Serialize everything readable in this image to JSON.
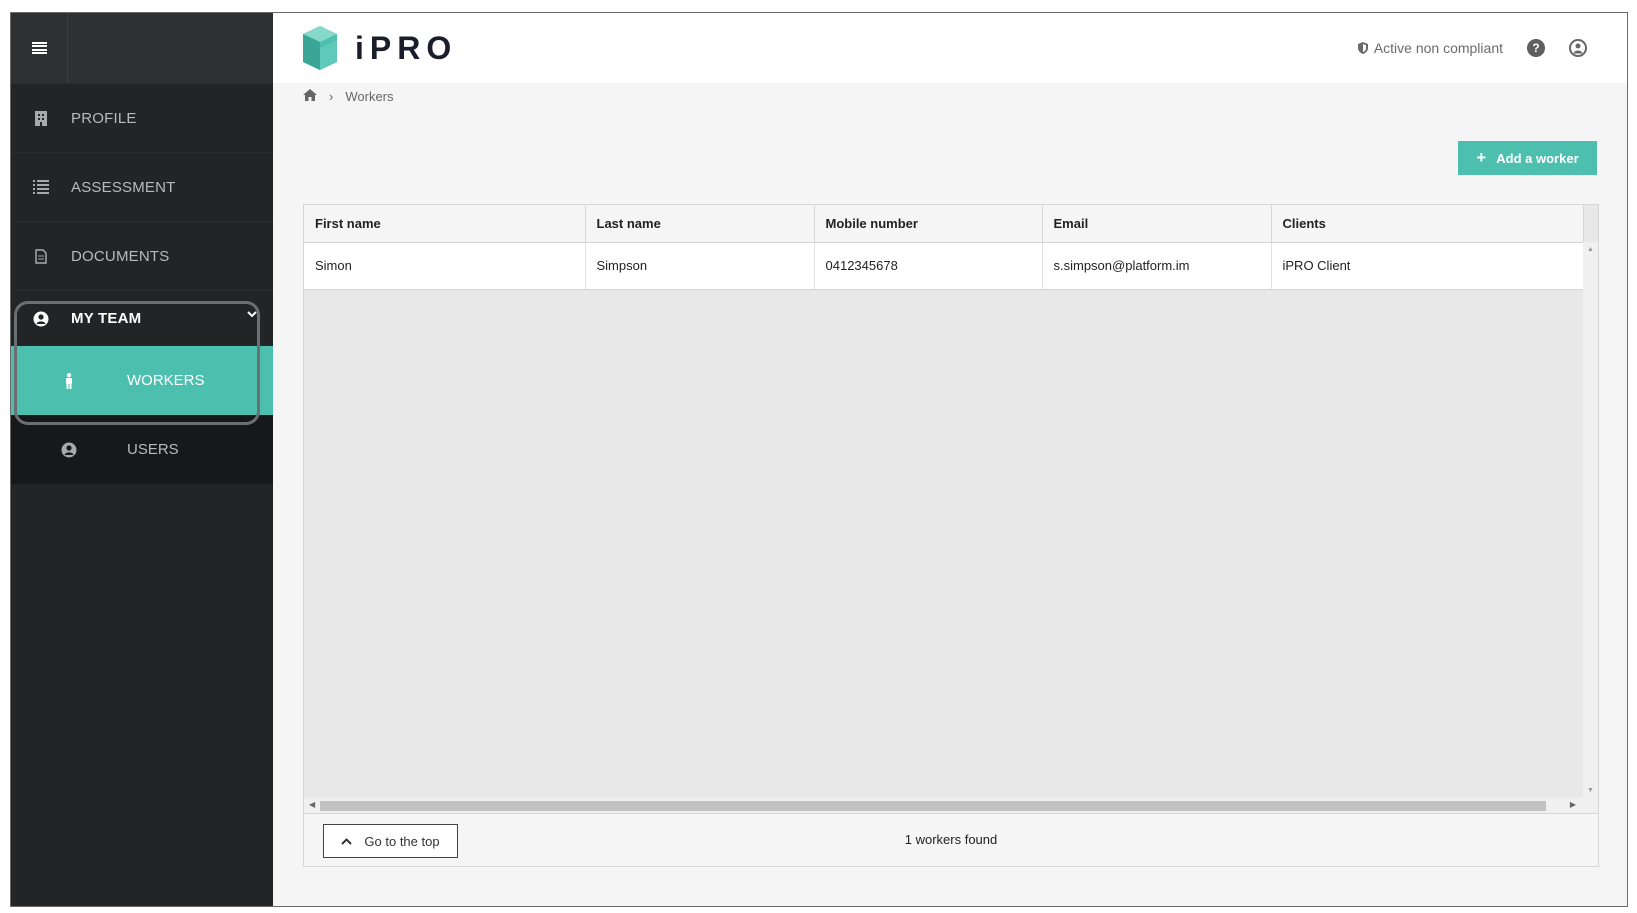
{
  "app": {
    "logo_text": "iPRO"
  },
  "header": {
    "status_text": "Active non compliant",
    "status_icon": "shield-icon",
    "help_icon": "question-circle-icon",
    "user_icon": "user-circle-icon"
  },
  "sidebar": {
    "menu_icon": "hamburger-menu-icon",
    "items": [
      {
        "label": "PROFILE",
        "icon": "building-icon"
      },
      {
        "label": "ASSESSMENT",
        "icon": "list-icon"
      },
      {
        "label": "DOCUMENTS",
        "icon": "document-icon"
      },
      {
        "label": "MY TEAM",
        "icon": "user-circle-icon"
      }
    ],
    "subitems": [
      {
        "label": "WORKERS",
        "icon": "person-icon",
        "active": true
      },
      {
        "label": "USERS",
        "icon": "user-circle-icon",
        "active": false
      }
    ]
  },
  "breadcrumb": {
    "home_icon": "home-icon",
    "current": "Workers"
  },
  "actions": {
    "add_label": "Add a worker"
  },
  "table": {
    "columns": [
      "First name",
      "Last name",
      "Mobile number",
      "Email",
      "Clients"
    ],
    "rows": [
      [
        "Simon",
        "Simpson",
        "0412345678",
        "s.simpson@platform.im",
        "iPRO Client"
      ]
    ]
  },
  "footer": {
    "top_label": "Go to the top",
    "count_text": "1 workers found"
  },
  "colors": {
    "accent": "#4dbfae",
    "sidebar_bg": "#232425",
    "logo_dark": "#1b1e2a"
  }
}
